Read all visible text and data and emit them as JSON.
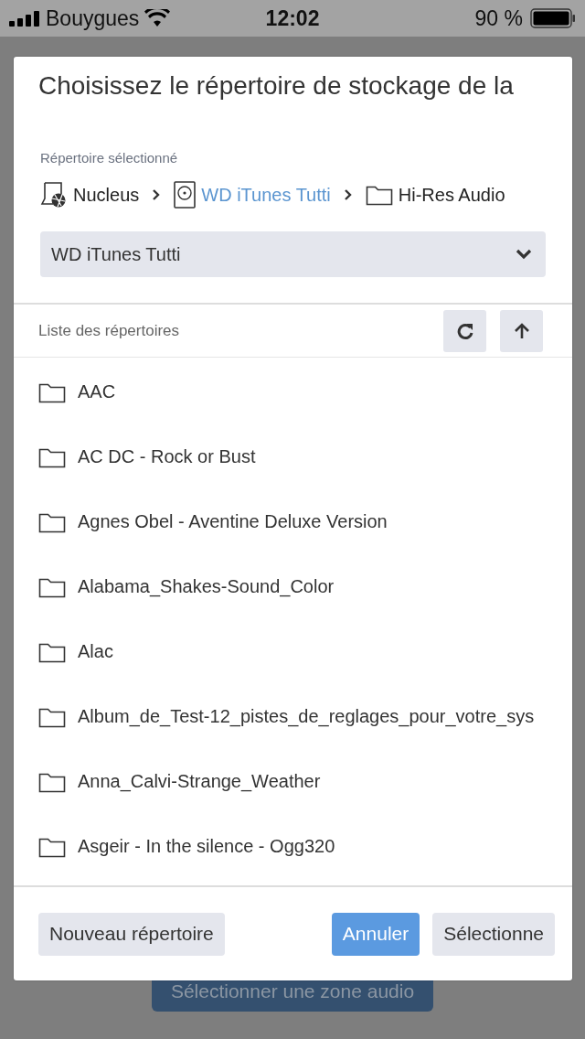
{
  "status_bar": {
    "carrier": "Bouygues",
    "time": "12:02",
    "battery": "90 %"
  },
  "background": {
    "button": "Sélectionner une zone audio"
  },
  "dialog": {
    "title": "Choisissez le répertoire de stockage de la",
    "selected_label": "Répertoire sélectionné",
    "breadcrumb": [
      {
        "kind": "computer",
        "label": "Nucleus",
        "link": false
      },
      {
        "kind": "disk",
        "label": "WD iTunes Tutti",
        "link": true
      },
      {
        "kind": "folder",
        "label": "Hi-Res Audio",
        "link": false
      }
    ],
    "drive_select": {
      "value": "WD iTunes Tutti"
    },
    "list_label": "Liste des répertoires",
    "folders": [
      "AAC",
      "AC DC - Rock or Bust",
      "Agnes Obel - Aventine Deluxe Version",
      "Alabama_Shakes-Sound_Color",
      "Alac",
      "Album_de_Test-12_pistes_de_reglages_pour_votre_sys",
      "Anna_Calvi-Strange_Weather",
      "Asgeir - In the silence - Ogg320"
    ],
    "buttons": [
      {
        "kind": "secondary",
        "label": "Nouveau répertoire"
      },
      {
        "kind": "primary",
        "label": "Annuler"
      },
      {
        "kind": "secondary",
        "label": "Sélectionne"
      }
    ]
  }
}
